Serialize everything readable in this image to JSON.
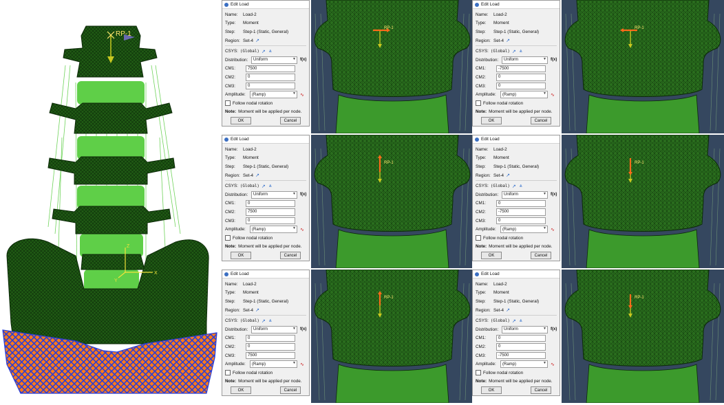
{
  "model": {
    "rp_label": "RP-1",
    "axis_z": "Z",
    "axis_x": "X",
    "axis_y": "Y"
  },
  "dialog_common": {
    "window_title": "Edit Load",
    "name_label": "Name:",
    "name_value": "Load-2",
    "type_label": "Type:",
    "type_value": "Moment",
    "step_label": "Step:",
    "step_value": "Step-1 (Static, General)",
    "region_label": "Region:",
    "region_value": "Set-4",
    "csys_label": "CSYS:",
    "csys_value": "(Global)",
    "distribution_label": "Distribution:",
    "distribution_value": "Uniform",
    "cm1_label": "CM1:",
    "cm2_label": "CM2:",
    "cm3_label": "CM3:",
    "amplitude_label": "Amplitude:",
    "amplitude_value": "(Ramp)",
    "follow_label": "Follow nodal rotation",
    "note_label": "Note:",
    "note_text": "Moment will be applied per node.",
    "ok_label": "OK",
    "cancel_label": "Cancel",
    "fx_label": "f(x)"
  },
  "dialogs": [
    {
      "cm1": "7500",
      "cm2": "0",
      "cm3": "0"
    },
    {
      "cm1": "-7500",
      "cm2": "0",
      "cm3": "0"
    },
    {
      "cm1": "0",
      "cm2": "7500",
      "cm3": "0"
    },
    {
      "cm1": "0",
      "cm2": "-7500",
      "cm3": "0"
    },
    {
      "cm1": "0",
      "cm2": "0",
      "cm3": "7500"
    },
    {
      "cm1": "0",
      "cm2": "0",
      "cm3": "-7500"
    }
  ],
  "viewports": [
    {
      "rp_label": "RP-1"
    },
    {
      "rp_label": "RP-1"
    },
    {
      "rp_label": "RP-1"
    },
    {
      "rp_label": "RP-1"
    },
    {
      "rp_label": "RP-1"
    },
    {
      "rp_label": "RP-1"
    }
  ],
  "colors": {
    "bone": "#1f5a14",
    "mesh_lines": "#0c2a08",
    "spring": "#6fd35a",
    "boundary_blue": "#2a3ed6",
    "boundary_orange": "#ff7a1a",
    "viewport_bg": "#35475f",
    "arrow_orange": "#ff6a1a",
    "arrow_yellow": "#c8c820"
  }
}
